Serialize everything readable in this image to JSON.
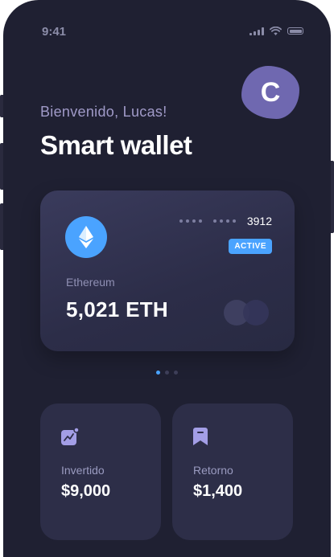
{
  "status_bar": {
    "time": "9:41"
  },
  "avatar": {
    "initial": "C"
  },
  "header": {
    "greeting": "Bienvenido, Lucas!",
    "title": "Smart wallet"
  },
  "card": {
    "masked_groups": [
      "••••",
      "••••"
    ],
    "last_digits": "3912",
    "status_badge": "ACTIVE",
    "coin_name": "Ethereum",
    "balance": "5,021 ETH",
    "coin_icon": "ethereum-icon"
  },
  "pager": {
    "count": 3,
    "active_index": 0
  },
  "stats": [
    {
      "label": "Invertido",
      "value": "$9,000",
      "icon": "chart-icon"
    },
    {
      "label": "Retorno",
      "value": "$1,400",
      "icon": "bookmark-icon"
    }
  ],
  "colors": {
    "background": "#1f2032",
    "accent": "#4aa3ff",
    "card": "#2d2e48",
    "avatar": "#6f68b0",
    "icon": "#a39ee6"
  }
}
